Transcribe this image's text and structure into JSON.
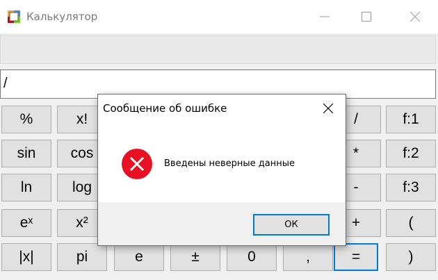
{
  "window": {
    "title": "Калькулятор",
    "icon": "calculator-app-icon"
  },
  "display": {
    "top_value": "",
    "input_value": "/"
  },
  "keys": [
    [
      "%",
      "x!",
      "",
      "",
      "",
      "/",
      "f:1"
    ],
    [
      "sin",
      "cos",
      "",
      "",
      "",
      "*",
      "f:2"
    ],
    [
      "ln",
      "log",
      "",
      "",
      "",
      "-",
      "f:3"
    ],
    [
      "eˣ",
      "x²",
      "",
      "",
      "",
      "+",
      "("
    ],
    [
      "|x|",
      "pi",
      "e",
      "±",
      "0",
      ",",
      "=",
      ")"
    ]
  ],
  "dialog": {
    "title": "Сообщение об ошибке",
    "message": "Введены неверные данные",
    "ok_label": "ОК",
    "icon": "error-icon"
  },
  "colors": {
    "accent": "#0078d7",
    "error_red": "#e81123"
  }
}
